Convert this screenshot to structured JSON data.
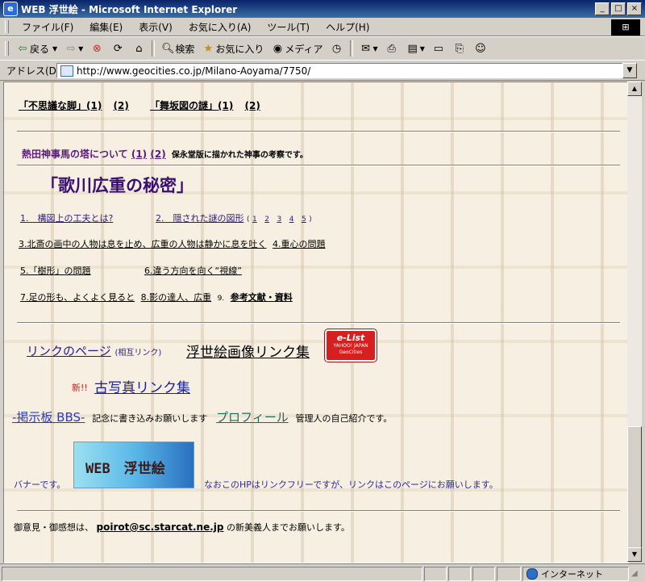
{
  "window": {
    "title": "WEB  浮世絵 - Microsoft Internet Explorer",
    "app_icon": "e"
  },
  "window_buttons": [
    "_",
    "□",
    "×"
  ],
  "menu": [
    "ファイル(F)",
    "編集(E)",
    "表示(V)",
    "お気に入り(A)",
    "ツール(T)",
    "ヘルプ(H)"
  ],
  "toolbar": {
    "back": "戻る",
    "search": "検索",
    "favorites": "お気に入り",
    "media": "メディア"
  },
  "address": {
    "label": "アドレス(D)",
    "url": "http://www.geocities.co.jp/Milano-Aoyama/7750/"
  },
  "content": {
    "top_links": {
      "a": "「不思議な脚」(1)",
      "a2": "(2)",
      "b": "「舞坂図の謎」(1)",
      "b2": "(2)"
    },
    "atsuta": {
      "title": "熱田神事馬の塔について",
      "p1": "(1)",
      "p2": "(2)",
      "note": "保永堂版に描かれた神事の考察です。"
    },
    "heading": "「歌川広重の秘密」",
    "items": {
      "i1": "1.　構図上の工夫とは?",
      "i2": "2.　隠された謎の図形",
      "i2_pages": [
        "1",
        "2",
        "3",
        "4",
        "5"
      ],
      "i2_close": ")",
      "i3": "3.北斎の画中の人物は息を止め、広重の人物は静かに息を吐く",
      "i4": "4.重心の問題",
      "i5": "5.「樹形」の問題",
      "i6": "6.違う方向を向く“視線”",
      "i7": "7.足の形も、よくよく見ると",
      "i8": "8.影の達人、広重",
      "i9_num": "9.",
      "i9": "参考文献・資料"
    },
    "links": {
      "link_page": "リンクのページ",
      "link_page_sub": "(相互リンク)",
      "ukiyoe_links": "浮世絵画像リンク集",
      "elist_badge": "e-List",
      "elist_sub": "YAHOO! JAPAN",
      "elist_sub2": "GeoCities",
      "new_label": "新!!",
      "old_photo": "古写真リンク集"
    },
    "bbs": {
      "link": "-掲示板 BBS-",
      "text": "記念に書き込みお願いします",
      "profile": "プロフィール",
      "profile_text": "管理人の自己紹介です。"
    },
    "banner": {
      "label": "バナーです。",
      "image_text": "WEB　浮世絵",
      "note": "なおこのHPはリンクフリーですが、リンクはこのページにお願いします。"
    },
    "contact": {
      "prefix": "御意見・御感想は、",
      "email": "poirot@sc.starcat.ne.jp",
      "suffix": "の新美義人までお願いします。"
    }
  },
  "statusbar": {
    "zone": "インターネット"
  }
}
